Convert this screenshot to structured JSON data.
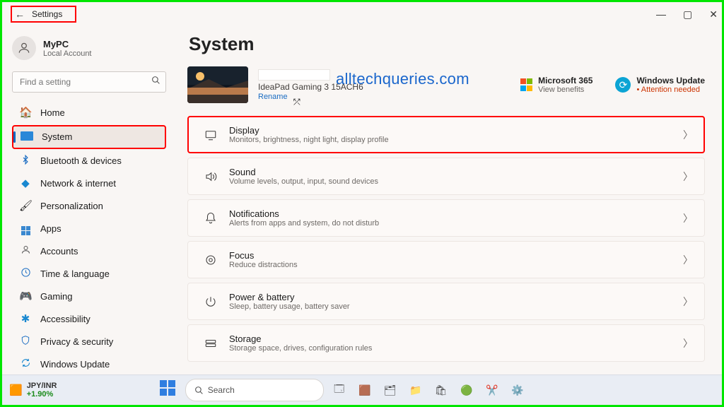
{
  "titlebar": {
    "title": "Settings"
  },
  "account": {
    "name": "MyPC",
    "subtitle": "Local Account"
  },
  "search": {
    "placeholder": "Find a setting"
  },
  "sidebar": {
    "items": [
      {
        "label": "Home",
        "icon": "🏠",
        "selected": false
      },
      {
        "label": "System",
        "icon": "🖥",
        "selected": true,
        "hl": true
      },
      {
        "label": "Bluetooth & devices",
        "icon": "bt",
        "selected": false
      },
      {
        "label": "Network & internet",
        "icon": "📶",
        "selected": false
      },
      {
        "label": "Personalization",
        "icon": "✏️",
        "selected": false
      },
      {
        "label": "Apps",
        "icon": "▦",
        "selected": false
      },
      {
        "label": "Accounts",
        "icon": "👤",
        "selected": false
      },
      {
        "label": "Time & language",
        "icon": "🕒",
        "selected": false
      },
      {
        "label": "Gaming",
        "icon": "🎮",
        "selected": false
      },
      {
        "label": "Accessibility",
        "icon": "✱",
        "selected": false
      },
      {
        "label": "Privacy & security",
        "icon": "🛡",
        "selected": false
      },
      {
        "label": "Windows Update",
        "icon": "🔄",
        "selected": false
      }
    ]
  },
  "content": {
    "heading": "System",
    "device": {
      "model": "IdeaPad Gaming 3 15ACH6",
      "rename": "Rename"
    },
    "promos": [
      {
        "title": "Microsoft 365",
        "subtitle": "View benefits"
      },
      {
        "title": "Windows Update",
        "subtitle": "Attention needed",
        "warn": true
      }
    ],
    "watermark": "alltechqueries.com",
    "cards": [
      {
        "title": "Display",
        "subtitle": "Monitors, brightness, night light, display profile",
        "icon": "display",
        "hl": true
      },
      {
        "title": "Sound",
        "subtitle": "Volume levels, output, input, sound devices",
        "icon": "sound"
      },
      {
        "title": "Notifications",
        "subtitle": "Alerts from apps and system, do not disturb",
        "icon": "bell"
      },
      {
        "title": "Focus",
        "subtitle": "Reduce distractions",
        "icon": "focus"
      },
      {
        "title": "Power & battery",
        "subtitle": "Sleep, battery usage, battery saver",
        "icon": "power"
      },
      {
        "title": "Storage",
        "subtitle": "Storage space, drives, configuration rules",
        "icon": "storage"
      }
    ]
  },
  "taskbar": {
    "currency": "JPY/INR",
    "pct": "+1.90%",
    "search": "Search"
  }
}
